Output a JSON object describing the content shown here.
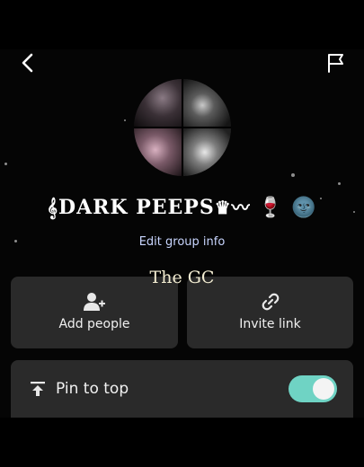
{
  "header": {
    "back_icon": "chevron-left-icon",
    "report_icon": "flag-icon"
  },
  "group": {
    "name": "DARK PEEPS",
    "name_prefix": "𝄞",
    "name_suffix": "♛〰",
    "emoji_1": "🍷",
    "emoji_2": "🌚",
    "edit_label": "Edit group info"
  },
  "overlay_caption": "The GC",
  "actions": {
    "add_people": {
      "label": "Add people",
      "icon": "add-person-icon"
    },
    "invite_link": {
      "label": "Invite link",
      "icon": "link-icon"
    }
  },
  "settings": {
    "pin_to_top": {
      "label": "Pin to top",
      "icon": "pin-top-icon",
      "enabled": true
    }
  },
  "colors": {
    "toggle_on": "#6fd3c4",
    "card_bg": "#2a2a2a",
    "edit_link": "#c9d6ff"
  }
}
